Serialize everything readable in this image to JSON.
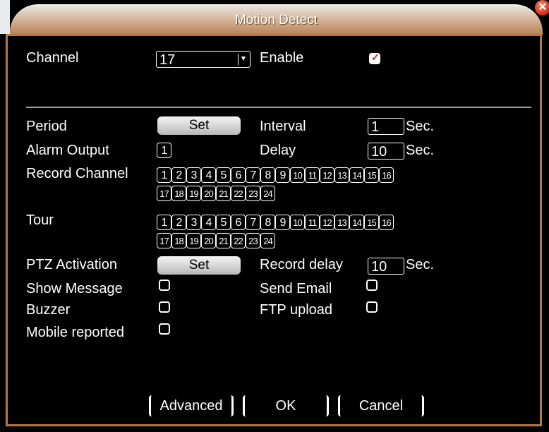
{
  "window": {
    "title": "Motion Detect",
    "close_icon": "close-icon"
  },
  "channel": {
    "label": "Channel",
    "value": "17"
  },
  "enable": {
    "label": "Enable",
    "checked": true
  },
  "period": {
    "label": "Period",
    "button": "Set"
  },
  "interval": {
    "label": "Interval",
    "value": "1",
    "unit": "Sec."
  },
  "alarm_output": {
    "label": "Alarm Output",
    "value": "1"
  },
  "delay": {
    "label": "Delay",
    "value": "10",
    "unit": "Sec."
  },
  "record_channel": {
    "label": "Record Channel",
    "row1": [
      "1",
      "2",
      "3",
      "4",
      "5",
      "6",
      "7",
      "8",
      "9",
      "10",
      "11",
      "12",
      "13",
      "14",
      "15",
      "16"
    ],
    "row2": [
      "17",
      "18",
      "19",
      "20",
      "21",
      "22",
      "23",
      "24"
    ]
  },
  "tour": {
    "label": "Tour",
    "row1": [
      "1",
      "2",
      "3",
      "4",
      "5",
      "6",
      "7",
      "8",
      "9",
      "10",
      "11",
      "12",
      "13",
      "14",
      "15",
      "16"
    ],
    "row2": [
      "17",
      "18",
      "19",
      "20",
      "21",
      "22",
      "23",
      "24"
    ]
  },
  "ptz_activation": {
    "label": "PTZ Activation",
    "button": "Set"
  },
  "record_delay": {
    "label": "Record delay",
    "value": "10",
    "unit": "Sec."
  },
  "show_message": {
    "label": "Show Message",
    "checked": false
  },
  "send_email": {
    "label": "Send Email",
    "checked": false
  },
  "buzzer": {
    "label": "Buzzer",
    "checked": false
  },
  "ftp_upload": {
    "label": "FTP upload",
    "checked": false
  },
  "mobile_reported": {
    "label": "Mobile reported",
    "checked": false
  },
  "buttons": {
    "advanced": "Advanced",
    "ok": "OK",
    "cancel": "Cancel"
  },
  "colors": {
    "frame": "#b77646",
    "check": "#e02020",
    "background": "#000000"
  }
}
